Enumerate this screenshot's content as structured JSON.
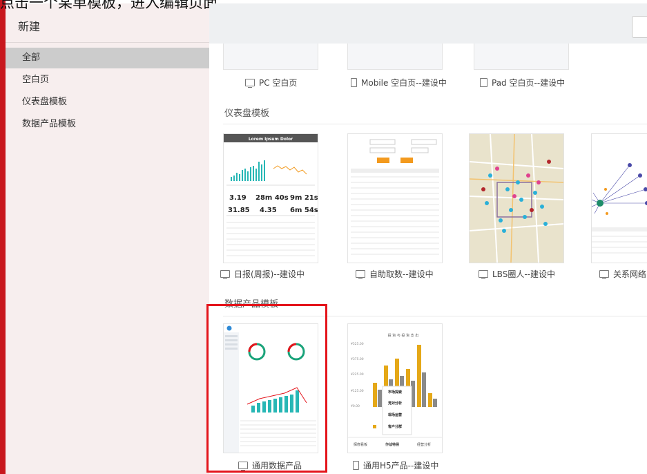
{
  "caption": "点击一个某单模板，进入编辑页面。",
  "sidebar": {
    "title": "新建",
    "items": [
      {
        "label": "全部",
        "active": true
      },
      {
        "label": "空白页",
        "active": false
      },
      {
        "label": "仪表盘模板",
        "active": false
      },
      {
        "label": "数据产品模板",
        "active": false
      }
    ]
  },
  "blank": {
    "items": [
      {
        "label": "PC 空白页",
        "icon": "monitor-icon"
      },
      {
        "label": "Mobile 空白页--建设中",
        "icon": "mobile-icon"
      },
      {
        "label": "Pad 空白页--建设中",
        "icon": "tablet-icon"
      }
    ]
  },
  "dashboard": {
    "title": "仪表盘模板",
    "items": [
      {
        "label": "日报(周报)--建设中",
        "icon": "monitor-icon"
      },
      {
        "label": "自助取数--建设中",
        "icon": "monitor-icon"
      },
      {
        "label": "LBS圈人--建设中",
        "icon": "monitor-icon"
      },
      {
        "label": "关系网络",
        "icon": "monitor-icon"
      }
    ],
    "daily": {
      "header": "Lorem Ipsum Dolor",
      "stats": [
        "3.19",
        "28m 40s",
        "9m 21s",
        "31.85",
        "4.35",
        "6m 54s"
      ]
    }
  },
  "data_product": {
    "title": "数据产品模板",
    "items": [
      {
        "label": "通用数据产品",
        "icon": "monitor-icon"
      },
      {
        "label": "通用H5产品--建设中",
        "icon": "mobile-icon"
      }
    ],
    "h5": {
      "title": "投 资 与 投 资 支 出",
      "yticks": [
        "¥525.00",
        "¥375.00",
        "¥225.00",
        "¥125.00",
        "¥0.00"
      ],
      "menu": [
        "市场探索",
        "竞对分析",
        "现场运营",
        "客户分群"
      ],
      "tabs": [
        "探修看板",
        "作战特展",
        "经营分析"
      ]
    }
  },
  "colors": {
    "accent": "#e4141b",
    "sidebar_bg": "#f7eeee",
    "active_item": "#cccccc",
    "teal": "#27b7b5",
    "gold": "#e5a818",
    "orange": "#f39a1e"
  }
}
